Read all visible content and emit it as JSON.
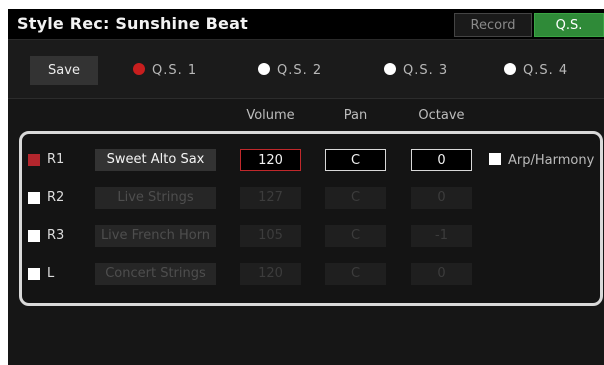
{
  "header": {
    "title": "Style Rec: Sunshine Beat",
    "tabs": [
      "Record",
      "Q.S."
    ]
  },
  "toolbar": {
    "save_label": "Save"
  },
  "quick_settings": [
    {
      "label": "Q.S. 1",
      "selected": true
    },
    {
      "label": "Q.S. 2",
      "selected": false
    },
    {
      "label": "Q.S. 3",
      "selected": false
    },
    {
      "label": "Q.S. 4",
      "selected": false
    }
  ],
  "columns": {
    "volume": "Volume",
    "pan": "Pan",
    "octave": "Octave"
  },
  "parts": [
    {
      "name": "R1",
      "voice": "Sweet Alto Sax",
      "volume": "120",
      "pan": "C",
      "octave": "0",
      "enabled": true
    },
    {
      "name": "R2",
      "voice": "Live Strings",
      "volume": "127",
      "pan": "C",
      "octave": "0",
      "enabled": false
    },
    {
      "name": "R3",
      "voice": "Live French Horn",
      "volume": "105",
      "pan": "C",
      "octave": "-1",
      "enabled": false
    },
    {
      "name": "L",
      "voice": "Concert Strings",
      "volume": "120",
      "pan": "C",
      "octave": "0",
      "enabled": false
    }
  ],
  "arp": {
    "label": "Arp/Harmony"
  },
  "colors": {
    "accent_green": "#2f8a38",
    "selected_red": "#c81e1e"
  }
}
